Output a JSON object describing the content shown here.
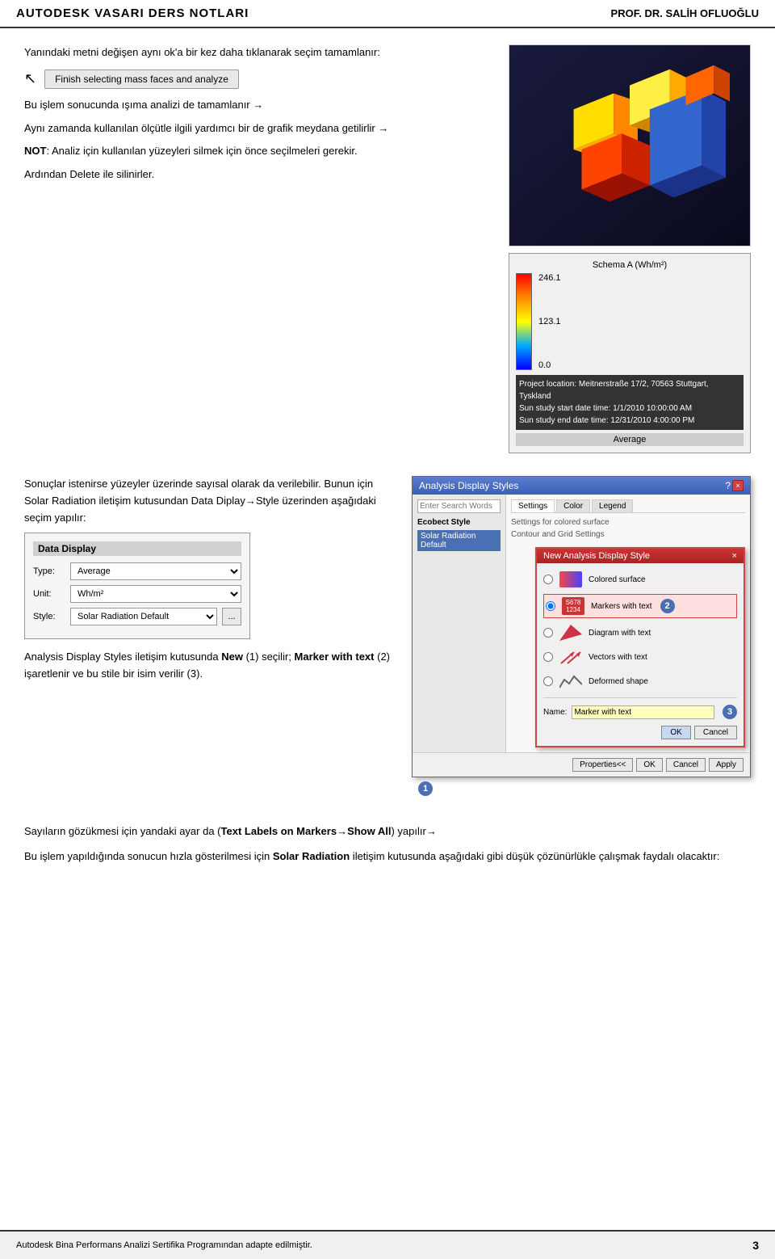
{
  "header": {
    "title": "AUTODESK VASARI DERS NOTLARI",
    "author": "PROF. DR. SALİH OFLUOĞLU"
  },
  "section1": {
    "para1": "Yanındaki metni değişen aynı ok'a bir kez daha tıklanarak seçim tamamlanır:",
    "finish_btn_label": "Finish selecting mass faces and analyze",
    "para2_prefix": "Bu işlem sonucunda ışıma analizi de tamamlanır",
    "para3_prefix": "Aynı zamanda kullanılan ölçütle ilgili yardımcı bir de grafik meydana getilirlir",
    "not_text": "NOT",
    "para4": ": Analiz için kullanılan yüzeyleri silmek için önce seçilmeleri gerekir.",
    "para5": "Ardından Delete ile silinirler."
  },
  "schema": {
    "title": "Schema A (Wh/m²)",
    "val_top": "246.1",
    "val_mid": "123.1",
    "val_bot": "0.0",
    "project_location": "Project location: Meitnerstraße 17/2, 70563 Stuttgart, Tyskland",
    "start_date": "Sun study start date time: 1/1/2010 10:00:00 AM",
    "end_date": "Sun study end date time: 12/31/2010 4:00:00 PM",
    "average": "Average"
  },
  "section2": {
    "para1": "Sonuçlar istenirse yüzeyler üzerinde sayısal olarak da verilebilir. Bunun için Solar Radiation iletişim kutusundan Data Diplay→Style üzerinden aşağıdaki seçim yapılır:",
    "data_display_title": "Data Display",
    "type_label": "Type:",
    "type_value": "Average",
    "unit_label": "Unit:",
    "unit_value": "Wh/m²",
    "style_label": "Style:",
    "style_value": "Solar Radiation Default",
    "btn_label": "...",
    "para2_prefix": "Analysis Display Styles iletişim kutusunda ",
    "new_label": "New",
    "para2_mid": " (1) seçilir; ",
    "marker_label": "Marker with text",
    "para2_end": " (2) işaretlenir ve bu stile bir isim verilir (3)."
  },
  "ads_dialog": {
    "title": "Analysis Display Styles",
    "question_mark": "?",
    "close_btn": "×",
    "search_placeholder": "Enter Search Words",
    "ecobect_style_label": "Ecobect Style",
    "solar_radiation_default": "Solar Radiation Default",
    "tab_settings": "Settings",
    "tab_color": "Color",
    "tab_legend": "Legend",
    "settings_text": "Settings for colored surface",
    "contour_text": "Contour and Grid Settings"
  },
  "nads_dialog": {
    "title": "New Analysis Display Style",
    "close_btn": "×",
    "option1": "Colored surface",
    "option2": "Markers with text",
    "markers_text": "S678\n1234",
    "option3": "Diagram with text",
    "option4": "Vectors with text",
    "option5": "Deformed shape",
    "name_label": "Name:",
    "name_value": "Marker with text",
    "ok_btn": "OK",
    "cancel_btn": "Cancel"
  },
  "bottom": {
    "para1": "Sayıların gözükmesi için yandaki ayar da (",
    "text_labels": "Text Labels on Markers",
    "show_all": "Show All",
    "para1_end": ") yapılır",
    "para2_prefix": "Bu işlem yapıldığında sonucun hızla gösterilmesi için ",
    "solar_radiation": "Solar Radiation",
    "para2_end": " iletişim kutusunda aşağıdaki gibi düşük çözünürlükle çalışmak faydalı olacaktır:"
  },
  "footer": {
    "text": "Autodesk Bina Performans Analizi Sertifika Programından adapte edilmiştir.",
    "page": "3"
  }
}
